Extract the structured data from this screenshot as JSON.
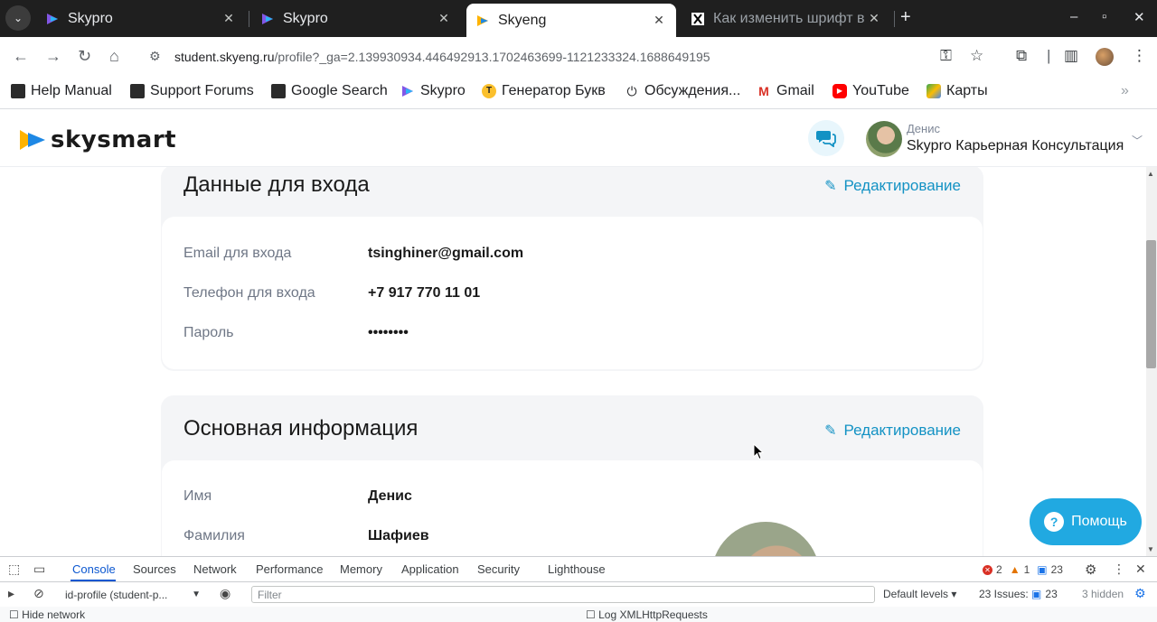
{
  "browser": {
    "tabs": [
      {
        "title": "Skypro",
        "favicon": "skypro-icon"
      },
      {
        "title": "Skypro",
        "favicon": "skypro-icon"
      },
      {
        "title": "Skyeng",
        "favicon": "skyeng-icon",
        "active": true
      },
      {
        "title": "Как изменить шрифт в",
        "favicon": "x-icon"
      }
    ],
    "url_host": "student.skyeng.ru",
    "url_path": "/profile?_ga=2.139930934.446492913.1702463699-1121233324.1688649195",
    "bookmarks": [
      "Help Manual",
      "Support Forums",
      "Google Search",
      "Skypro",
      "Генератор Букв",
      "Обсуждения...",
      "Gmail",
      "YouTube",
      "Карты"
    ]
  },
  "site": {
    "logo_text": "skysmart",
    "user_first_name": "Денис",
    "user_display_name": "Skypro Карьерная Консультация"
  },
  "login_card": {
    "title": "Данные для входа",
    "edit_label": "Редактирование",
    "rows": [
      {
        "label": "Email для входа",
        "value": "tsinghiner@gmail.com"
      },
      {
        "label": "Телефон для входа",
        "value": "+7 917 770 11 01"
      },
      {
        "label": "Пароль",
        "value": "••••••••"
      }
    ]
  },
  "main_card": {
    "title": "Основная информация",
    "edit_label": "Редактирование",
    "rows": [
      {
        "label": "Имя",
        "value": "Денис"
      },
      {
        "label": "Фамилия",
        "value": "Шафиев"
      }
    ]
  },
  "help_button": {
    "label": "Помощь"
  },
  "devtools": {
    "tabs": [
      "Console",
      "Sources",
      "Network",
      "Performance",
      "Memory",
      "Application",
      "Security",
      "Lighthouse"
    ],
    "active_tab": "Console",
    "errors": "2",
    "warnings": "1",
    "messages": "23",
    "context": "id-profile (student-p...",
    "filter_placeholder": "Filter",
    "levels": "Default levels",
    "issues_label": "23 Issues:",
    "issues_count": "23",
    "hidden": "3 hidden",
    "hide_network": "Hide network",
    "log_xhr": "Log XMLHttpRequests"
  }
}
